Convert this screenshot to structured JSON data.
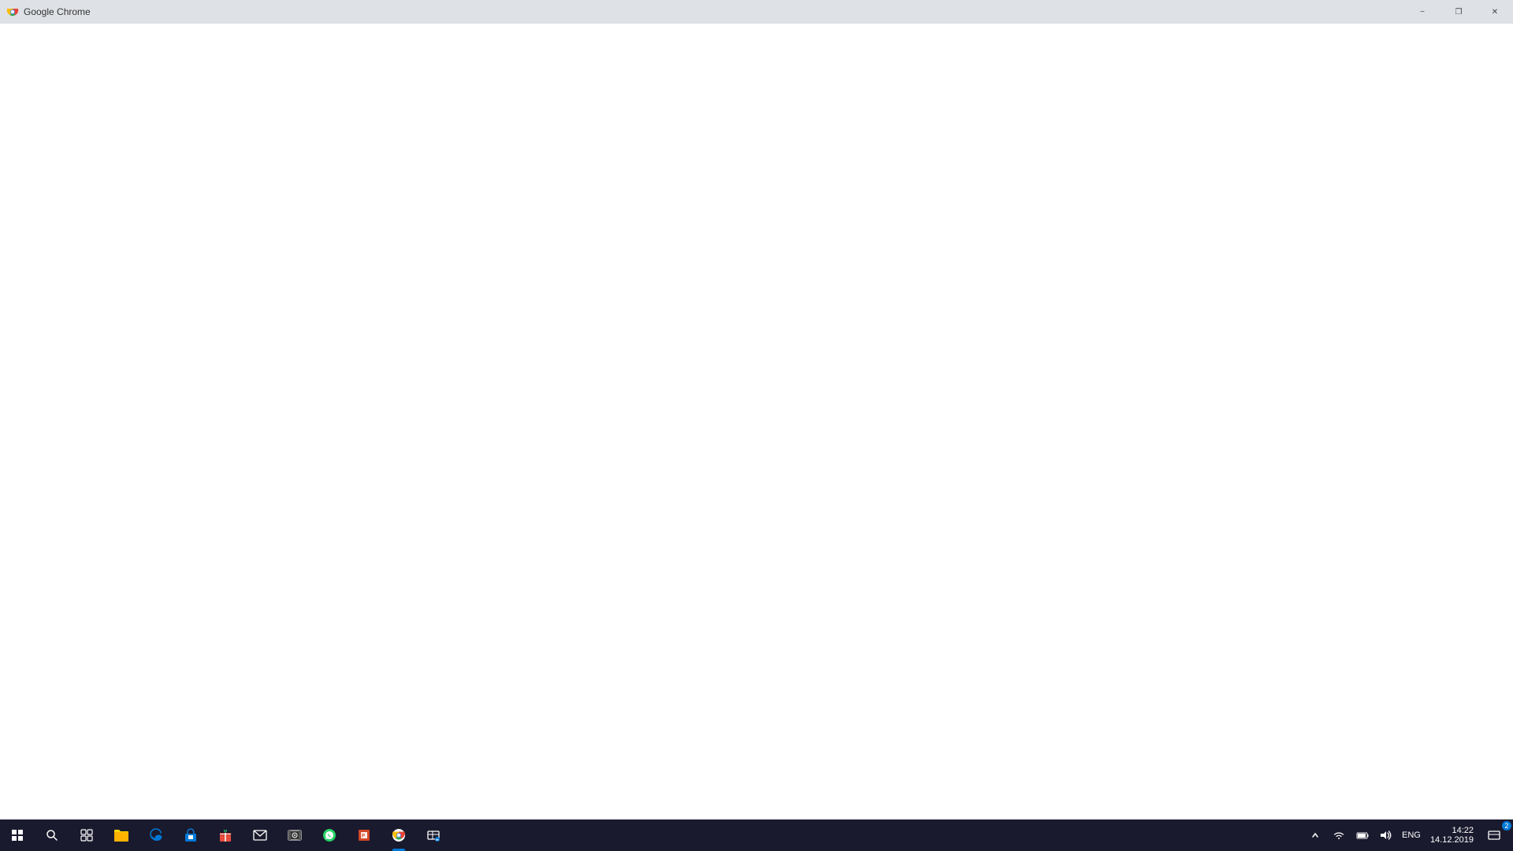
{
  "title_bar": {
    "app_name": "Google Chrome",
    "minimize_label": "−",
    "restore_label": "❐",
    "close_label": "✕"
  },
  "browser": {
    "content": ""
  },
  "taskbar": {
    "time": "14:22",
    "date": "14.12.2019",
    "lang": "ENG",
    "icons": [
      {
        "name": "start",
        "label": "Start"
      },
      {
        "name": "search",
        "label": "Search"
      },
      {
        "name": "task-view",
        "label": "Task View"
      },
      {
        "name": "file-explorer",
        "label": "File Explorer"
      },
      {
        "name": "edge",
        "label": "Microsoft Edge"
      },
      {
        "name": "store",
        "label": "Microsoft Store"
      },
      {
        "name": "gift",
        "label": "Gift"
      },
      {
        "name": "mail",
        "label": "Mail"
      },
      {
        "name": "media",
        "label": "Media"
      },
      {
        "name": "whatsapp",
        "label": "WhatsApp"
      },
      {
        "name": "powerpoint",
        "label": "PowerPoint"
      },
      {
        "name": "chrome",
        "label": "Google Chrome"
      },
      {
        "name": "snip",
        "label": "Snipping Tool"
      }
    ],
    "sys_tray": {
      "chevron": "^",
      "network": "wifi",
      "battery": "🔋",
      "volume": "🔊"
    },
    "notification_badge": "2"
  }
}
